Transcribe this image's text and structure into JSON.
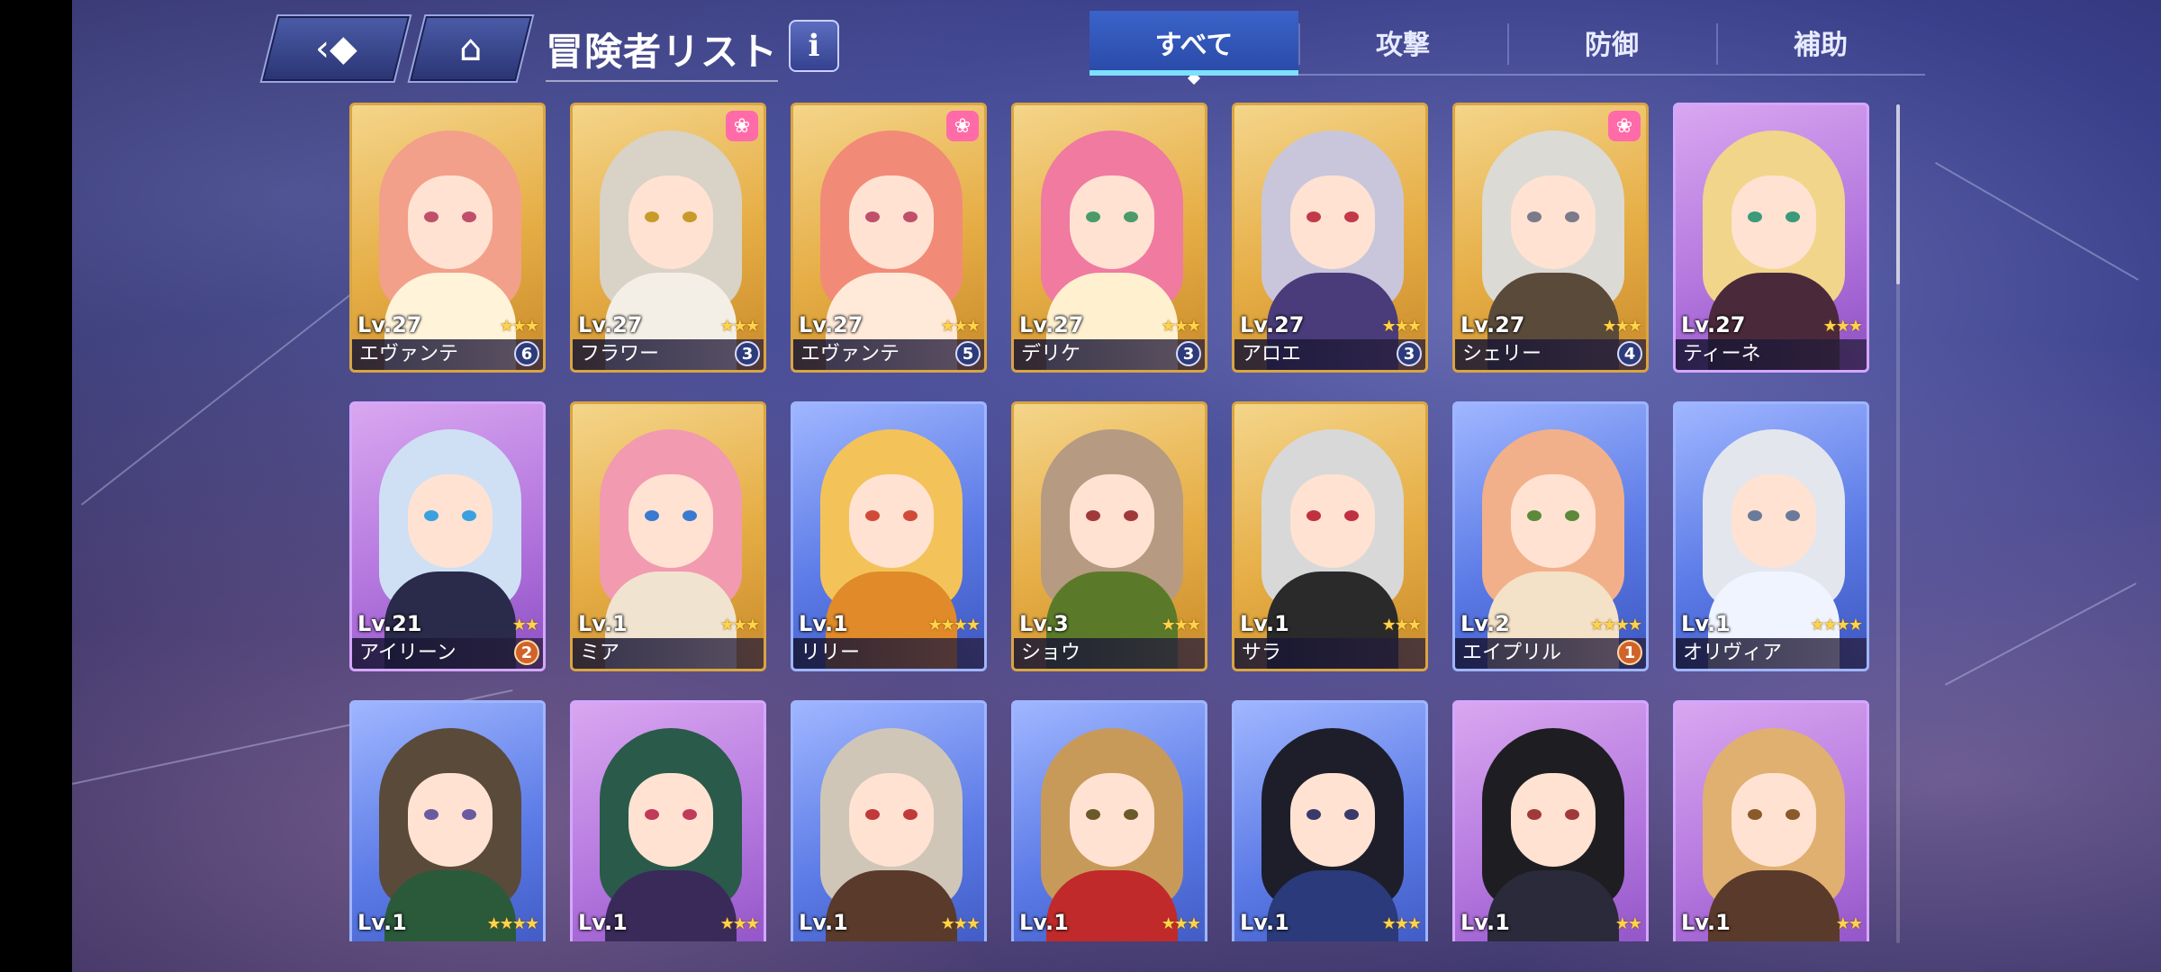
{
  "header": {
    "back_icon": "back-arrow-icon",
    "home_icon": "home-icon",
    "title": "冒険者リスト",
    "info_label": "i"
  },
  "tabs": [
    {
      "label": "すべて",
      "active": true
    },
    {
      "label": "攻撃",
      "active": false
    },
    {
      "label": "防御",
      "active": false
    },
    {
      "label": "補助",
      "active": false
    }
  ],
  "colors": {
    "gold": "#e6ad45",
    "purple": "#b477de",
    "blue": "#5c7be6",
    "active_tab": "#2a4aa8",
    "tab_underline": "#7de0ff",
    "star": "#ffd34a"
  },
  "cards": [
    {
      "level": "Lv.27",
      "name": "エヴァンテ",
      "stars": "★★★",
      "badge": "6",
      "rarity": "gold",
      "hair": "#f2a08a",
      "eye": "#c0506a",
      "outfit": "#fff3d9",
      "pet": false
    },
    {
      "level": "Lv.27",
      "name": "フラワー",
      "stars": "★★★",
      "badge": "3",
      "rarity": "gold",
      "hair": "#d9d2c6",
      "eye": "#c89a2a",
      "outfit": "#f4efe6",
      "pet": true
    },
    {
      "level": "Lv.27",
      "name": "エヴァンテ",
      "stars": "★★★",
      "badge": "5",
      "rarity": "gold",
      "hair": "#f28a78",
      "eye": "#c0506a",
      "outfit": "#ffe9d8",
      "pet": true
    },
    {
      "level": "Lv.27",
      "name": "デリケ",
      "stars": "★★★",
      "badge": "3",
      "rarity": "gold",
      "hair": "#f07aa0",
      "eye": "#4c9a6a",
      "outfit": "#fff1d0",
      "pet": false
    },
    {
      "level": "Lv.27",
      "name": "アロエ",
      "stars": "★★★",
      "badge": "3",
      "rarity": "gold",
      "hair": "#c9c6dc",
      "eye": "#c23a4a",
      "outfit": "#4a3b7a",
      "pet": false
    },
    {
      "level": "Lv.27",
      "name": "シェリー",
      "stars": "★★★",
      "badge": "4",
      "rarity": "gold",
      "hair": "#dcdad4",
      "eye": "#7a7a8a",
      "outfit": "#5a4a3a",
      "pet": true
    },
    {
      "level": "Lv.27",
      "name": "ティーネ",
      "stars": "★★★",
      "badge": "",
      "rarity": "purple",
      "hair": "#f1d58a",
      "eye": "#3a9a7a",
      "outfit": "#4a2a3a",
      "pet": false
    },
    {
      "level": "Lv.21",
      "name": "アイリーン",
      "stars": "★★",
      "badge": "2",
      "badge_style": "orange",
      "rarity": "purple",
      "hair": "#cfe0f5",
      "eye": "#3aa0e0",
      "outfit": "#2a2a4a",
      "pet": false
    },
    {
      "level": "Lv.1",
      "name": "ミア",
      "stars": "★★★",
      "badge": "",
      "rarity": "gold",
      "hair": "#f29ab0",
      "eye": "#3a7ad0",
      "outfit": "#f0e4d0",
      "pet": false
    },
    {
      "level": "Lv.1",
      "name": "リリー",
      "stars": "★★★★",
      "badge": "",
      "rarity": "blue",
      "hair": "#f3c35a",
      "eye": "#d04a3a",
      "outfit": "#e08a2a",
      "pet": false
    },
    {
      "level": "Lv.3",
      "name": "ショウ",
      "stars": "★★★",
      "badge": "",
      "rarity": "gold",
      "hair": "#b69a82",
      "eye": "#a03a3a",
      "outfit": "#5a7a2a",
      "pet": false
    },
    {
      "level": "Lv.1",
      "name": "サラ",
      "stars": "★★★",
      "badge": "",
      "rarity": "gold",
      "hair": "#d8d8d8",
      "eye": "#c03040",
      "outfit": "#2a2a2a",
      "pet": false
    },
    {
      "level": "Lv.2",
      "name": "エイプリル",
      "stars": "★★★★",
      "badge": "1",
      "badge_style": "orange",
      "rarity": "blue",
      "hair": "#f2b08a",
      "eye": "#5a8a3a",
      "outfit": "#f4e2c8",
      "pet": false
    },
    {
      "level": "Lv.1",
      "name": "オリヴィア",
      "stars": "★★★★",
      "badge": "",
      "rarity": "blue",
      "hair": "#e4e6ee",
      "eye": "#6a7a9a",
      "outfit": "#f0f4ff",
      "pet": false
    },
    {
      "level": "Lv.1",
      "name": "",
      "stars": "★★★★",
      "badge": "",
      "rarity": "blue",
      "hair": "#5a4a3a",
      "eye": "#6a5aa0",
      "outfit": "#2a5a3a",
      "pet": false
    },
    {
      "level": "Lv.1",
      "name": "",
      "stars": "★★★",
      "badge": "",
      "rarity": "purple",
      "hair": "#2a5a4a",
      "eye": "#c03a5a",
      "outfit": "#3a2a5a",
      "pet": false
    },
    {
      "level": "Lv.1",
      "name": "",
      "stars": "★★★",
      "badge": "",
      "rarity": "blue",
      "hair": "#cfc6b8",
      "eye": "#c03a3a",
      "outfit": "#5a3a2a",
      "pet": false
    },
    {
      "level": "Lv.1",
      "name": "",
      "stars": "★★★",
      "badge": "",
      "rarity": "blue",
      "hair": "#c89a5a",
      "eye": "#6a5a2a",
      "outfit": "#c02a2a",
      "pet": false
    },
    {
      "level": "Lv.1",
      "name": "",
      "stars": "★★★",
      "badge": "",
      "rarity": "blue",
      "hair": "#1e1e2a",
      "eye": "#3a3a6a",
      "outfit": "#2a3a7a",
      "pet": false
    },
    {
      "level": "Lv.1",
      "name": "",
      "stars": "★★",
      "badge": "",
      "rarity": "purple",
      "hair": "#1e1e22",
      "eye": "#a03a3a",
      "outfit": "#2a2a3a",
      "pet": false
    },
    {
      "level": "Lv.1",
      "name": "",
      "stars": "★★",
      "badge": "",
      "rarity": "purple",
      "hair": "#e0b070",
      "eye": "#8a5a2a",
      "outfit": "#5a3a2a",
      "pet": false
    }
  ]
}
